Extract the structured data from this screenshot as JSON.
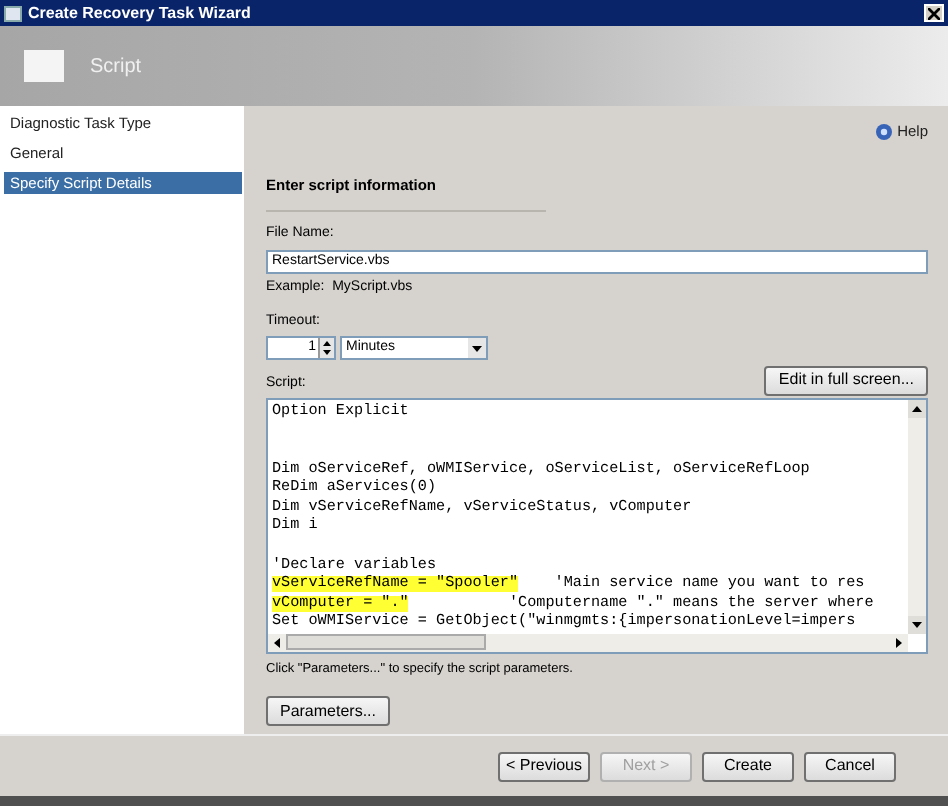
{
  "window": {
    "title": "Create Recovery Task Wizard"
  },
  "header": {
    "title": "Script"
  },
  "sidebar": {
    "items": [
      {
        "label": "Diagnostic Task Type",
        "selected": false
      },
      {
        "label": "General",
        "selected": false
      },
      {
        "label": "Specify Script Details",
        "selected": true
      }
    ]
  },
  "help": "Help",
  "section_title": "Enter script information",
  "file_name": {
    "label": "File Name:",
    "value": "RestartService.vbs",
    "example": "Example:  MyScript.vbs"
  },
  "timeout": {
    "label": "Timeout:",
    "value": "1",
    "unit": "Minutes"
  },
  "script": {
    "label": "Script:",
    "edit_button": "Edit in full screen...",
    "lines": [
      [
        {
          "text": "Option Explicit",
          "highlighted": false
        }
      ],
      [
        {
          "kind": "blank"
        }
      ],
      [
        {
          "kind": "blank"
        }
      ],
      [
        {
          "text": "Dim oServiceRef, oWMIService, oServiceList, oServiceRefLoop",
          "highlighted": false
        }
      ],
      [
        {
          "text": "ReDim aServices(0)",
          "highlighted": false
        }
      ],
      [
        {
          "text": "Dim vServiceRefName, vServiceStatus, vComputer",
          "highlighted": false
        }
      ],
      [
        {
          "text": "Dim i",
          "highlighted": false
        }
      ],
      [
        {
          "kind": "blank"
        }
      ],
      [
        {
          "text": "'Declare variables",
          "highlighted": false
        }
      ],
      [
        {
          "text": "vServiceRefName = \"Spooler\"",
          "highlighted": true
        },
        {
          "text": "    'Main service name you want to res",
          "highlighted": false
        }
      ],
      [
        {
          "text": "vComputer = \".\"",
          "highlighted": true
        },
        {
          "text": "           'Computername \".\" means the server where",
          "highlighted": false
        }
      ],
      [
        {
          "text": "Set oWMIService = GetObject(\"winmgmts:{impersonationLevel=impers",
          "highlighted": false
        }
      ]
    ]
  },
  "parameters_hint": "Click \"Parameters...\" to specify the script parameters.",
  "parameters_button": "Parameters...",
  "buttons": [
    {
      "label": "< Previous",
      "disabled": false
    },
    {
      "label": "Next >",
      "disabled": true
    },
    {
      "label": "Create",
      "disabled": false
    },
    {
      "label": "Cancel",
      "disabled": false
    }
  ]
}
